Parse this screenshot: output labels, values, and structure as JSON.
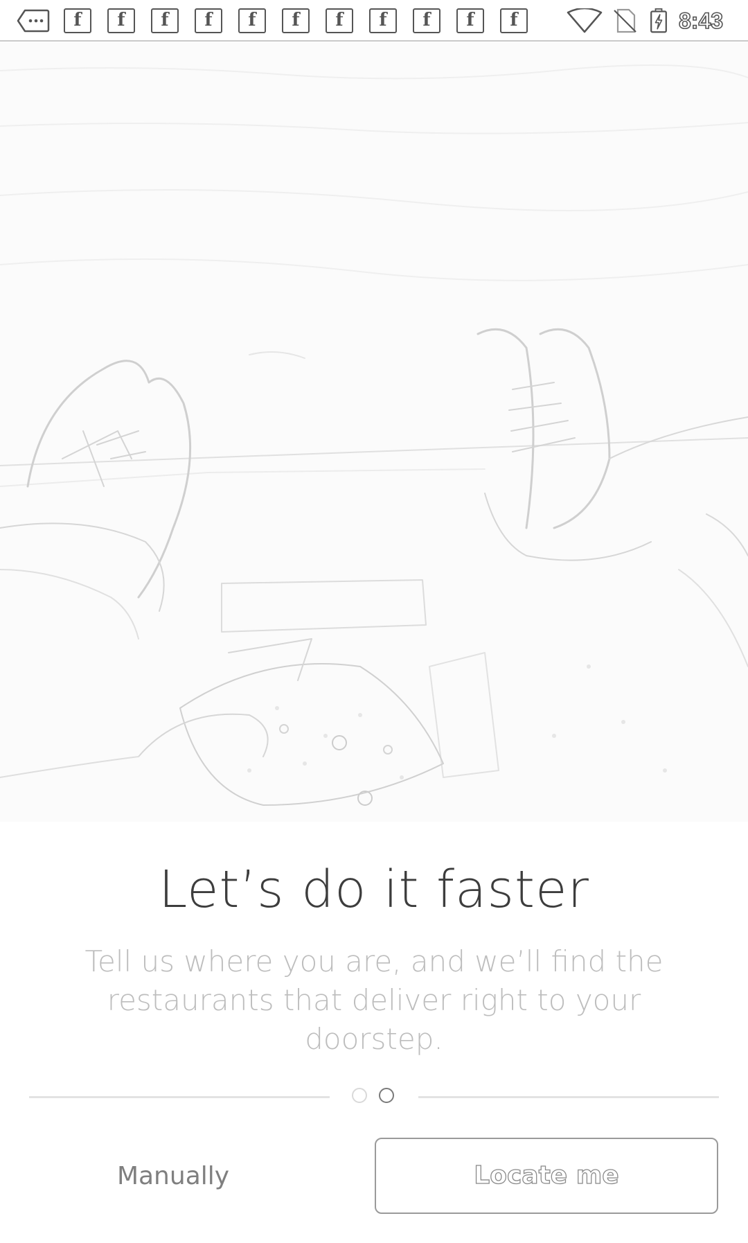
{
  "status_bar": {
    "time": "8:43",
    "fb_glyph": "f",
    "icons": [
      "message-icon",
      "facebook-icon",
      "wifi-icon",
      "no-sim-icon",
      "battery-charging-icon"
    ],
    "notification_count": 11
  },
  "hero": {
    "image": "feet-and-pizza-sketch"
  },
  "onboarding": {
    "title": "Let’s do it faster",
    "description": "Tell us where you are, and we’ll find the restaurants that deliver right to your doorstep."
  },
  "pager": {
    "pages": 2,
    "current": 2
  },
  "actions": {
    "manual_label": "Manually",
    "locate_label": "Locate me"
  }
}
